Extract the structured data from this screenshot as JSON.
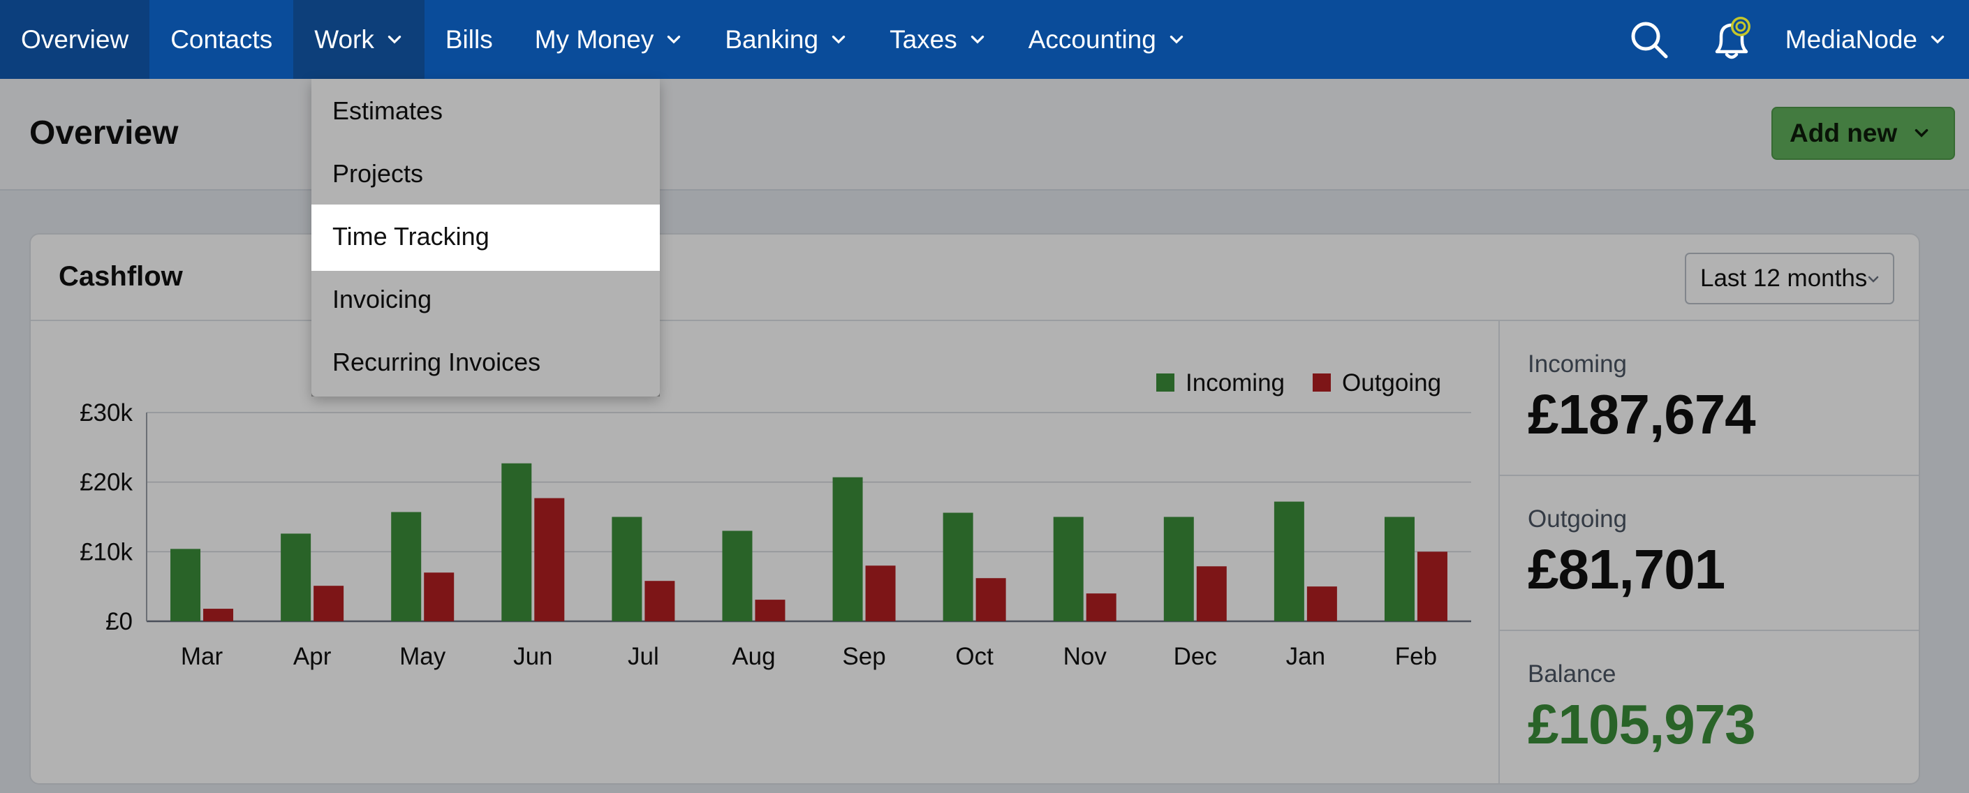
{
  "nav": {
    "items": [
      {
        "label": "Overview",
        "dropdown": false
      },
      {
        "label": "Contacts",
        "dropdown": false
      },
      {
        "label": "Work",
        "dropdown": true
      },
      {
        "label": "Bills",
        "dropdown": false
      },
      {
        "label": "My Money",
        "dropdown": true
      },
      {
        "label": "Banking",
        "dropdown": true
      },
      {
        "label": "Taxes",
        "dropdown": true
      },
      {
        "label": "Accounting",
        "dropdown": true
      }
    ],
    "account_label": "MediaNode",
    "search_icon": "search-icon",
    "notification_icon": "bell-icon"
  },
  "work_menu": {
    "items": [
      "Estimates",
      "Projects",
      "Time Tracking",
      "Invoicing",
      "Recurring Invoices"
    ],
    "highlighted": "Time Tracking"
  },
  "page": {
    "title": "Overview",
    "add_new_label": "Add new"
  },
  "cashflow": {
    "title": "Cashflow",
    "period": "Last 12 months"
  },
  "stats": {
    "incoming_label": "Incoming",
    "incoming_value": "£187,674",
    "outgoing_label": "Outgoing",
    "outgoing_value": "£81,701",
    "balance_label": "Balance",
    "balance_value": "£105,973"
  },
  "colors": {
    "nav_bg": "#0a4c9a",
    "incoming": "#3c8f3a",
    "outgoing": "#b41f22",
    "add_new": "#61b15c"
  },
  "chart_data": {
    "type": "bar",
    "title": "",
    "xlabel": "",
    "ylabel": "",
    "categories": [
      "Mar",
      "Apr",
      "May",
      "Jun",
      "Jul",
      "Aug",
      "Sep",
      "Oct",
      "Nov",
      "Dec",
      "Jan",
      "Feb"
    ],
    "series": [
      {
        "name": "Incoming",
        "values": [
          10400,
          12600,
          15700,
          22700,
          15000,
          13000,
          20700,
          15600,
          15000,
          15000,
          17200,
          15000
        ]
      },
      {
        "name": "Outgoing",
        "values": [
          1800,
          5100,
          7000,
          17700,
          5800,
          3100,
          8000,
          6200,
          4000,
          7900,
          5000,
          10000
        ]
      }
    ],
    "yticks": [
      "£0",
      "£10k",
      "£20k",
      "£30k"
    ],
    "ytick_values": [
      0,
      10000,
      20000,
      30000
    ],
    "ylim": [
      0,
      30000
    ],
    "grid": true,
    "legend": "top-right"
  }
}
